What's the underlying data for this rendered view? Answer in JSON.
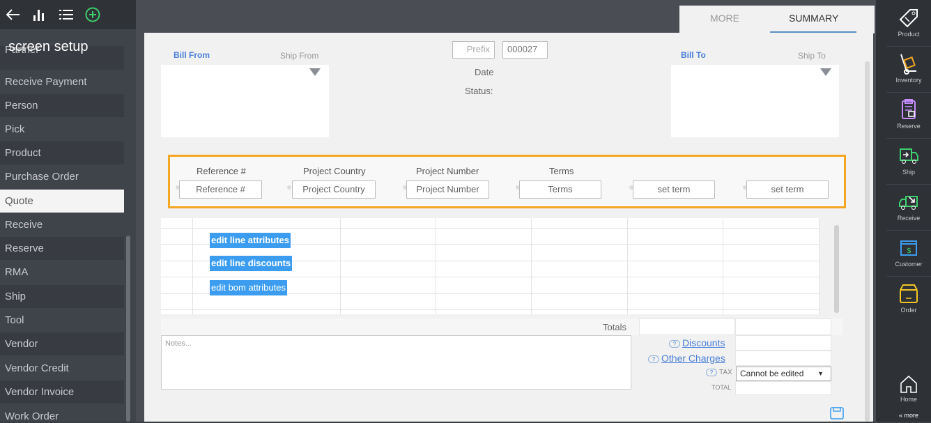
{
  "sidebar": {
    "title": "screen setup",
    "partial_item": "Partner",
    "items": [
      {
        "label": "Receive Payment"
      },
      {
        "label": "Person"
      },
      {
        "label": "Pick"
      },
      {
        "label": "Product"
      },
      {
        "label": "Purchase Order"
      },
      {
        "label": "Quote"
      },
      {
        "label": "Receive"
      },
      {
        "label": "Reserve"
      },
      {
        "label": "RMA"
      },
      {
        "label": "Ship"
      },
      {
        "label": "Tool"
      },
      {
        "label": "Vendor"
      },
      {
        "label": "Vendor Credit"
      },
      {
        "label": "Vendor Invoice"
      },
      {
        "label": "Work Order"
      }
    ],
    "active": "Quote"
  },
  "tabs": {
    "more": "MORE",
    "summary": "SUMMARY"
  },
  "header": {
    "bill_from": "Bill From",
    "ship_from": "Ship From",
    "bill_to": "Bill To",
    "ship_to": "Ship To",
    "prefix_placeholder": "Prefix",
    "doc_number": "000027",
    "date_label": "Date",
    "status_label": "Status:"
  },
  "reference": {
    "headers": [
      "Reference #",
      "Project Country",
      "Project Number",
      "Terms"
    ],
    "fields": [
      "Reference #",
      "Project Country",
      "Project Number",
      "Terms",
      "set term",
      "set term"
    ]
  },
  "lines": {
    "edit_line_attributes": "edit line attributes",
    "edit_line_discounts": "edit line discounts",
    "edit_bom_attributes": "edit bom attributes"
  },
  "totals": {
    "totals_label": "Totals",
    "notes_placeholder": "Notes...",
    "discounts": "Discounts",
    "other_charges": "Other Charges",
    "tax": "TAX",
    "tax_value": "Cannot be edited",
    "total": "TOTAL"
  },
  "right_bar": {
    "items": [
      "Product",
      "Inventory",
      "Reserve",
      "Ship",
      "Receive",
      "Customer",
      "Order"
    ],
    "home": "Home",
    "more": "« more"
  }
}
